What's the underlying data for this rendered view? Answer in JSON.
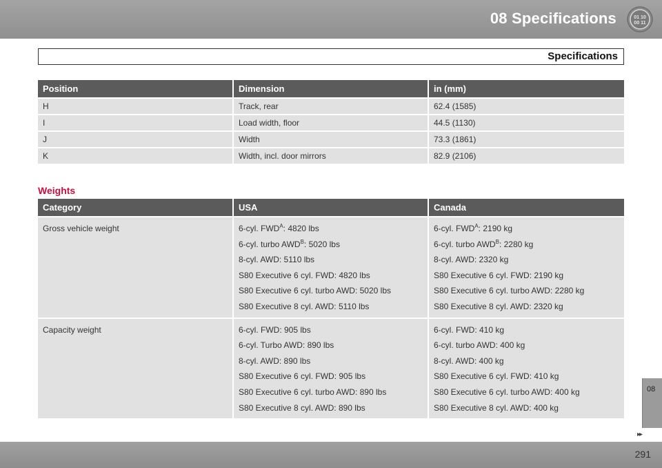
{
  "header": {
    "chapter_title": "08 Specifications",
    "icon": "specifications-chapter-icon",
    "icon_digits": [
      "01 10",
      "00 11"
    ]
  },
  "section": {
    "title": "Specifications"
  },
  "dimensions_table": {
    "headers": [
      "Position",
      "Dimension",
      "in (mm)"
    ],
    "rows": [
      [
        "H",
        "Track, rear",
        "62.4 (1585)"
      ],
      [
        "I",
        "Load width, floor",
        "44.5 (1130)"
      ],
      [
        "J",
        "Width",
        "73.3 (1861)"
      ],
      [
        "K",
        "Width, incl. door mirrors",
        "82.9 (2106)"
      ]
    ]
  },
  "weights": {
    "heading": "Weights",
    "headers": [
      "Category",
      "USA",
      "Canada"
    ],
    "rows": [
      {
        "category": "Gross vehicle weight",
        "usa": [
          {
            "pre": "6-cyl. FWD",
            "sup": "A",
            "post": ": 4820 lbs"
          },
          {
            "pre": "6-cyl. turbo AWD",
            "sup": "B",
            "post": ": 5020 lbs"
          },
          {
            "pre": "8-cyl. AWD: 5110 lbs",
            "sup": "",
            "post": ""
          },
          {
            "pre": "S80 Executive 6 cyl. FWD: 4820 lbs",
            "sup": "",
            "post": ""
          },
          {
            "pre": "S80 Executive 6 cyl. turbo AWD: 5020 lbs",
            "sup": "",
            "post": ""
          },
          {
            "pre": "S80 Executive 8 cyl. AWD: 5110 lbs",
            "sup": "",
            "post": ""
          }
        ],
        "canada": [
          {
            "pre": "6-cyl. FWD",
            "sup": "A",
            "post": ": 2190 kg"
          },
          {
            "pre": "6-cyl. turbo AWD",
            "sup": "B",
            "post": ": 2280 kg"
          },
          {
            "pre": "8-cyl. AWD: 2320 kg",
            "sup": "",
            "post": ""
          },
          {
            "pre": "S80 Executive 6 cyl. FWD: 2190 kg",
            "sup": "",
            "post": ""
          },
          {
            "pre": "S80 Executive 6 cyl. turbo AWD: 2280 kg",
            "sup": "",
            "post": ""
          },
          {
            "pre": "S80 Executive 8 cyl. AWD: 2320 kg",
            "sup": "",
            "post": ""
          }
        ]
      },
      {
        "category": "Capacity weight",
        "usa": [
          {
            "pre": "6-cyl. FWD: 905 lbs",
            "sup": "",
            "post": ""
          },
          {
            "pre": "6-cyl. Turbo AWD: 890 lbs",
            "sup": "",
            "post": ""
          },
          {
            "pre": "8-cyl. AWD: 890 lbs",
            "sup": "",
            "post": ""
          },
          {
            "pre": "S80 Executive 6 cyl. FWD: 905 lbs",
            "sup": "",
            "post": ""
          },
          {
            "pre": "S80 Executive 6 cyl. turbo AWD: 890 lbs",
            "sup": "",
            "post": ""
          },
          {
            "pre": "S80 Executive 8 cyl. AWD: 890 lbs",
            "sup": "",
            "post": ""
          }
        ],
        "canada": [
          {
            "pre": "6-cyl. FWD: 410 kg",
            "sup": "",
            "post": ""
          },
          {
            "pre": "6-cyl. turbo AWD: 400 kg",
            "sup": "",
            "post": ""
          },
          {
            "pre": "8-cyl. AWD: 400 kg",
            "sup": "",
            "post": ""
          },
          {
            "pre": "S80 Executive 6 cyl. FWD: 410 kg",
            "sup": "",
            "post": ""
          },
          {
            "pre": "S80 Executive 6 cyl. turbo AWD: 400 kg",
            "sup": "",
            "post": ""
          },
          {
            "pre": "S80 Executive 8 cyl. AWD: 400 kg",
            "sup": "",
            "post": ""
          }
        ]
      }
    ]
  },
  "side_tab": {
    "label": "08",
    "arrows": "▸▸"
  },
  "footer": {
    "page_number": "291"
  },
  "colors": {
    "header_gray": "#999999",
    "table_header": "#5b5b5b",
    "table_cell": "#e1e1e1",
    "weights_heading": "#c8103e"
  }
}
